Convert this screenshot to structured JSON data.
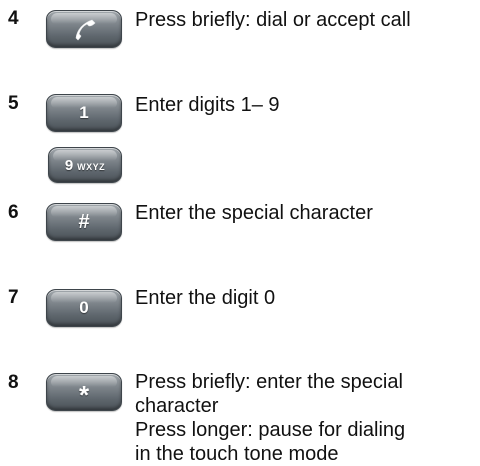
{
  "items": [
    {
      "number": "4",
      "icon": "phone-handset-icon",
      "lines": [
        "Press briefly: dial or accept call"
      ]
    },
    {
      "number": "5",
      "icon": "digit-keys",
      "key_labels": [
        "1",
        "9",
        "WXYZ"
      ],
      "lines": [
        "Enter digits 1– 9"
      ]
    },
    {
      "number": "6",
      "icon": "hash-key",
      "key_label": "#",
      "lines": [
        "Enter the special character"
      ]
    },
    {
      "number": "7",
      "icon": "zero-key",
      "key_label": "0",
      "lines": [
        "Enter the digit 0"
      ]
    },
    {
      "number": "8",
      "icon": "star-key",
      "key_label": "*",
      "lines": [
        "Press briefly: enter the special",
        "character",
        "Press longer: pause for dialing",
        "in the touch tone mode"
      ]
    }
  ]
}
